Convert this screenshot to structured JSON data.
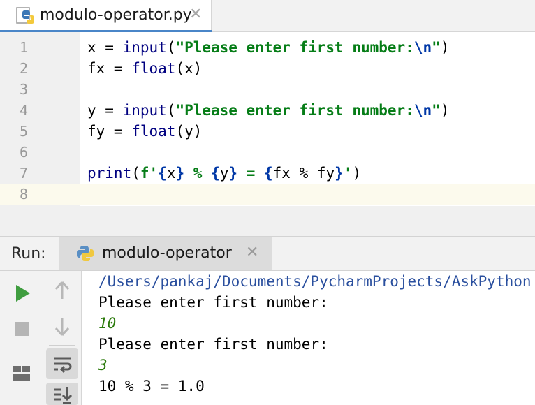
{
  "editor": {
    "tab": {
      "label": "modulo-operator.py",
      "close": "✕"
    },
    "lines": [
      {
        "n": "1",
        "tokens": [
          {
            "t": "x = ",
            "c": "plain"
          },
          {
            "t": "input",
            "c": "fn"
          },
          {
            "t": "(",
            "c": "plain"
          },
          {
            "t": "\"Please enter first number:",
            "c": "str"
          },
          {
            "t": "\\n",
            "c": "esc"
          },
          {
            "t": "\"",
            "c": "str"
          },
          {
            "t": ")",
            "c": "plain"
          }
        ]
      },
      {
        "n": "2",
        "tokens": [
          {
            "t": "fx = ",
            "c": "plain"
          },
          {
            "t": "float",
            "c": "fn"
          },
          {
            "t": "(x)",
            "c": "plain"
          }
        ]
      },
      {
        "n": "3",
        "tokens": []
      },
      {
        "n": "4",
        "tokens": [
          {
            "t": "y = ",
            "c": "plain"
          },
          {
            "t": "input",
            "c": "fn"
          },
          {
            "t": "(",
            "c": "plain"
          },
          {
            "t": "\"Please enter first number:",
            "c": "str"
          },
          {
            "t": "\\n",
            "c": "esc"
          },
          {
            "t": "\"",
            "c": "str"
          },
          {
            "t": ")",
            "c": "plain"
          }
        ]
      },
      {
        "n": "5",
        "tokens": [
          {
            "t": "fy = ",
            "c": "plain"
          },
          {
            "t": "float",
            "c": "fn"
          },
          {
            "t": "(y)",
            "c": "plain"
          }
        ]
      },
      {
        "n": "6",
        "tokens": []
      },
      {
        "n": "7",
        "tokens": [
          {
            "t": "print",
            "c": "fn"
          },
          {
            "t": "(",
            "c": "plain"
          },
          {
            "t": "f'",
            "c": "str"
          },
          {
            "t": "{",
            "c": "brace"
          },
          {
            "t": "x",
            "c": "plain"
          },
          {
            "t": "}",
            "c": "brace"
          },
          {
            "t": " % ",
            "c": "str"
          },
          {
            "t": "{",
            "c": "brace"
          },
          {
            "t": "y",
            "c": "plain"
          },
          {
            "t": "}",
            "c": "brace"
          },
          {
            "t": " = ",
            "c": "str"
          },
          {
            "t": "{",
            "c": "brace"
          },
          {
            "t": "fx % fy",
            "c": "plain"
          },
          {
            "t": "}",
            "c": "brace"
          },
          {
            "t": "'",
            "c": "str"
          },
          {
            "t": ")",
            "c": "plain"
          }
        ]
      },
      {
        "n": "8",
        "tokens": [],
        "current": true
      }
    ]
  },
  "run": {
    "label": "Run:",
    "tab": {
      "label": "modulo-operator",
      "close": "✕"
    },
    "toolbar_icons": [
      "run-icon",
      "stop-icon",
      "layout-icon",
      "up-arrow-icon",
      "down-arrow-icon",
      "soft-wrap-icon",
      "scroll-to-end-icon"
    ],
    "console": [
      {
        "text": "/Users/pankaj/Documents/PycharmProjects/AskPython",
        "kind": "path"
      },
      {
        "text": "Please enter first number:",
        "kind": "output"
      },
      {
        "text": "10",
        "kind": "input"
      },
      {
        "text": "Please enter first number:",
        "kind": "output"
      },
      {
        "text": "3",
        "kind": "input"
      },
      {
        "text": "10 % 3 = 1.0",
        "kind": "output"
      }
    ]
  },
  "colors": {
    "accent": "#4a86c8",
    "run_green": "#3f9d3f",
    "string": "#067d17",
    "keyword_fn": "#000080"
  }
}
